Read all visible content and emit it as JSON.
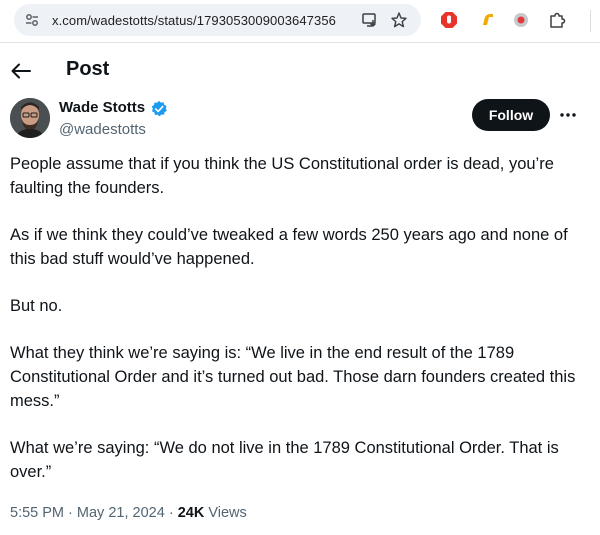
{
  "browser": {
    "url": "x.com/wadestotts/status/1793053009003647356"
  },
  "header": {
    "title": "Post"
  },
  "author": {
    "name": "Wade Stotts",
    "handle": "@wadestotts",
    "follow_label": "Follow",
    "verified": true
  },
  "tweet": {
    "paragraphs": [
      "People assume that if you think the US Constitutional order is dead, you’re faulting the founders.",
      "As if we think they could’ve tweaked a few words 250 years ago and none of this bad stuff would’ve happened.",
      "But no.",
      "What they think we’re saying is: “We live in the end result of the 1789 Constitutional Order and it’s turned out bad. Those darn founders created this mess.”",
      "What we’re saying: “We do not live in the 1789 Constitutional Order. That is over.”"
    ]
  },
  "meta": {
    "time": "5:55 PM",
    "date": "May 21, 2024",
    "separator": "·",
    "views_count": "24K",
    "views_label": "Views"
  },
  "colors": {
    "text_primary": "#0f1419",
    "text_secondary": "#536471",
    "verified_blue": "#1d9bf0",
    "follow_bg": "#0f1419"
  },
  "icons": [
    "site-info-icon",
    "install-app-icon",
    "bookmark-star-icon",
    "adblock-icon",
    "extension-pencil-icon",
    "extension-circle-icon",
    "extensions-puzzle-icon",
    "back-arrow-icon",
    "verified-badge-icon",
    "more-options-icon"
  ]
}
